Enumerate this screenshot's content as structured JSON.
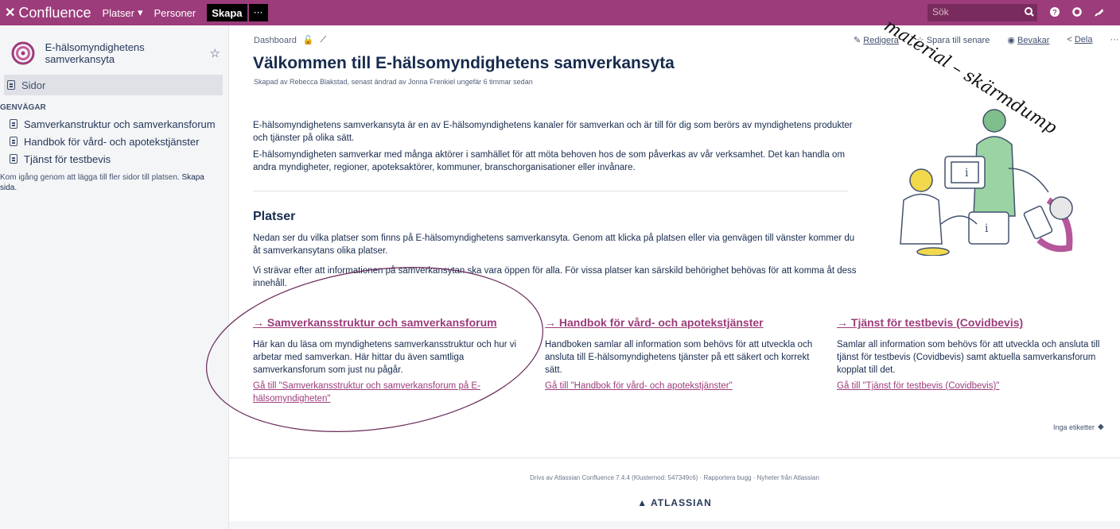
{
  "topbar": {
    "logo_text": "Confluence",
    "nav": [
      "Platser",
      "Personer"
    ],
    "create_label": "Skapa",
    "more_label": "···",
    "search_placeholder": "Sök"
  },
  "sidebar": {
    "space_name": "E-hälsomyndighetens samverkansyta",
    "pages_label": "Sidor",
    "shortcuts_heading": "GENVÄGAR",
    "shortcuts": [
      "Samverkanstruktur och samverkansforum",
      "Handbok för vård- och apotekstjänster",
      "Tjänst för testbevis"
    ],
    "hint_text": "Kom igång genom att lägga till fler sidor till platsen.",
    "hint_link": "Skapa sida."
  },
  "page": {
    "breadcrumb": "Dashboard",
    "actions": {
      "edit": "Redigera",
      "save_later": "Spara till senare",
      "watch": "Bevakar",
      "share": "Dela",
      "more": "···"
    },
    "title": "Välkommen till E-hälsomyndighetens samverkansyta",
    "byline": "Skapad av Rebecca Blakstad, senast ändrad av Jonna Frenkiel ungefär 6 timmar sedan",
    "intro_1": "E-hälsomyndighetens samverkansyta är en av E-hälsomyndighetens kanaler för samverkan och är till för dig som berörs av myndighetens produkter och tjänster på olika sätt.",
    "intro_2": "E-hälsomyndigheten samverkar med många aktörer i samhället för att möta behoven hos de som påverkas av vår verksamhet. Det kan handla om andra myndigheter, regioner, apoteksaktörer, kommuner, branschorganisationer eller invånare.",
    "section_heading": "Platser",
    "section_p1": "Nedan ser du vilka platser som finns på E-hälsomyndighetens samverkansyta. Genom att klicka på platsen eller via genvägen till vänster kommer du åt samverkansytans olika platser.",
    "section_p2": "Vi strävar efter att informationen på samverkansytan ska vara öppen för alla. För vissa platser kan särskild behörighet behövas för att komma åt dess innehåll.",
    "columns": [
      {
        "heading": "→ Samverkansstruktur och samverkansforum",
        "text": "Här kan du läsa om myndighetens samverkansstruktur och hur vi arbetar med samverkan. Här hittar du även samtliga samverkansforum som just nu pågår.",
        "link": "Gå till \"Samverkansstruktur och samverkansforum på E-hälsomyndigheten\""
      },
      {
        "heading": "→ Handbok för vård- och apotekstjänster",
        "text": "Handboken samlar all information som behövs för att utveckla och ansluta till E-hälsomyndighetens tjänster på ett säkert och korrekt sätt.",
        "link": "Gå till \"Handbok för vård- och apotekstjänster\""
      },
      {
        "heading": "→ Tjänst för testbevis (Covidbevis)",
        "text": "Samlar all information som behövs för att utveckla och ansluta till tjänst för testbevis (Covidbevis) samt aktuella samverkansforum kopplat till det.",
        "link": "Gå till \"Tjänst för testbevis (Covidbevis)\""
      }
    ],
    "labels_text": "Inga etiketter"
  },
  "footer": {
    "powered_by": "Drivs av Atlassian Confluence 7.4.4 (Klusternod: 547349c6)",
    "report_bug": "Rapportera bugg",
    "news": "Nyheter från Atlassian",
    "atlassian": "ATLASSIAN"
  },
  "watermark": "material – skärmdump",
  "colors": {
    "brand": "#9c3c7b",
    "topbar": "#9c3c7b",
    "sidebar_bg": "#f4f5f7",
    "link": "#9c3c7b"
  },
  "icons": [
    "confluence-logo-icon",
    "chevron-down-icon",
    "search-icon",
    "help-icon",
    "settings-icon",
    "notification-icon",
    "star-icon",
    "page-icon",
    "lock-icon",
    "link-icon",
    "edit-icon",
    "eye-icon",
    "share-icon",
    "tag-icon",
    "atlassian-logo-icon"
  ]
}
